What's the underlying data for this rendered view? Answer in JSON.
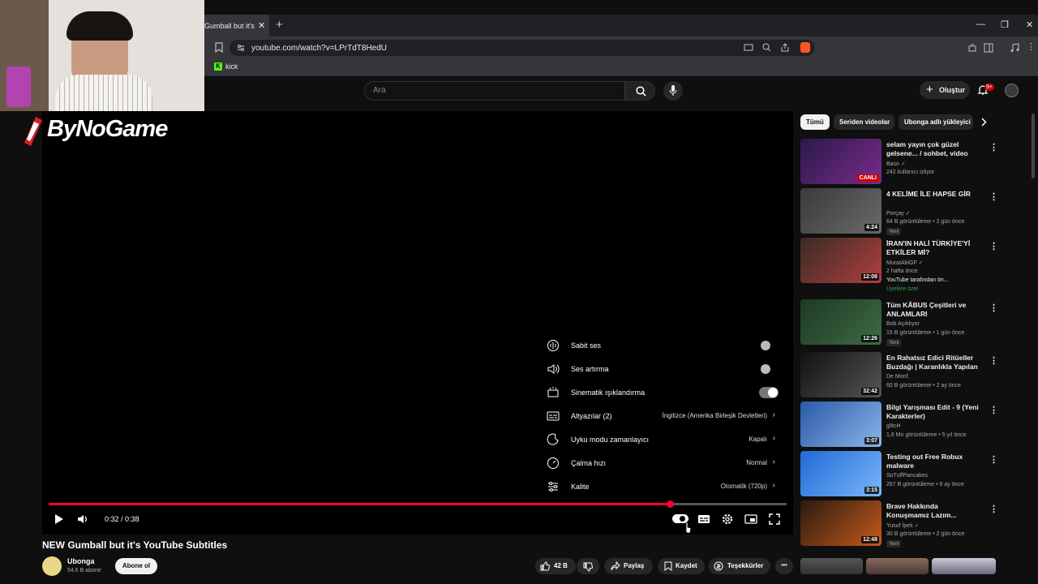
{
  "browser": {
    "tab_title": "Gumball but it's",
    "tab_close": "✕",
    "new_tab": "+",
    "url": "youtube.com/watch?v=LPrTdT8HedU",
    "bookmark_kick": "kick",
    "win_min": "—",
    "win_max": "❐",
    "win_close": "✕"
  },
  "header": {
    "search_placeholder": "Ara",
    "create_label": "Oluştur",
    "notif_count": "9+"
  },
  "overlay": {
    "logo_text": "ByNoGame"
  },
  "settings_menu": {
    "items": [
      {
        "label": "Sabit ses",
        "value": "",
        "icon": "volume-bars-icon",
        "control": "toggle-off"
      },
      {
        "label": "Ses artırma",
        "value": "",
        "icon": "volume-boost-icon",
        "control": "toggle-off"
      },
      {
        "label": "Sinematik ışıklandırma",
        "value": "",
        "icon": "ambient-mode-icon",
        "control": "toggle-on"
      },
      {
        "label": "Altyazılar (2)",
        "value": "İngilizce (Amerika Birleşik Devletleri)",
        "icon": "subtitles-icon",
        "control": "chevron"
      },
      {
        "label": "Uyku modu zamanlayıcı",
        "value": "Kapalı",
        "icon": "sleep-timer-icon",
        "control": "chevron"
      },
      {
        "label": "Çalma hızı",
        "value": "Normal",
        "icon": "playback-speed-icon",
        "control": "chevron"
      },
      {
        "label": "Kalite",
        "value": "Otomatik (720p)",
        "icon": "quality-icon",
        "control": "chevron"
      }
    ],
    "chevron": "›"
  },
  "player": {
    "time": "0:32 / 0:38",
    "progress": 0.842
  },
  "video": {
    "title": "NEW Gumball but it's YouTube Subtitles",
    "channel": "Ubonga",
    "subs": "54.6 B abone",
    "subscribe_label": "Abone ol",
    "likes": "42 B",
    "share_label": "Paylaş",
    "save_label": "Kaydet",
    "thanks_label": "Teşekkürler",
    "more": "•••"
  },
  "sidebar": {
    "chips": [
      "Tümü",
      "Seriden videolar",
      "Ubonga adlı yükleyici"
    ],
    "more": "⋮",
    "recs": [
      {
        "title": "selam yayın çok güzel gelsene... / sohbet, video izleme / zula(?)...",
        "channel": "Baso ✓",
        "meta": "242 kullanıcı izliyor",
        "badge": "",
        "dur": "",
        "live": "CANLI",
        "c1": "#2a1a4a",
        "c2": "#7a2a8a"
      },
      {
        "title": "4 KELİME İLE HAPSE GİR",
        "channel": "Porçay ✓",
        "meta": "64 B görüntüleme • 2 gün önce",
        "badge": "Yeni",
        "dur": "4:24",
        "live": "",
        "c1": "#3a3a3a",
        "c2": "#6a6a6a"
      },
      {
        "title": "İRAN'IN HALİ TÜRKİYE'Yİ ETKİLER Mİ? @YusufKayaalp ...",
        "channel": "MuratAbiGF ✓",
        "meta": "2 hafta önce",
        "badge": "",
        "dur": "12:08",
        "live": "",
        "c1": "#3a2a24",
        "c2": "#b04040"
      },
      {
        "title": "Tüm KÂBUS Çeşitleri ve ANLAMLARI",
        "channel": "Bob Açıklıyor",
        "meta": "15 B görüntüleme • 1 gün önce",
        "badge": "Yeni",
        "dur": "12:26",
        "live": "",
        "c1": "#1e3a24",
        "c2": "#3e6a44"
      },
      {
        "title": "En Rahatsız Edici Ritüeller Buzdağı | Karanlıkla Yapılan ...",
        "channel": "De Monf.",
        "meta": "60 B görüntüleme • 2 ay önce",
        "badge": "",
        "dur": "32:42",
        "live": "",
        "c1": "#111111",
        "c2": "#555555"
      },
      {
        "title": "Bilgi Yarışması Edit - 9 (Yeni Karakterler)",
        "channel": "glitcH",
        "meta": "1,6 Mn görüntüleme • 5 yıl önce",
        "badge": "",
        "dur": "3:07",
        "live": "",
        "c1": "#2a5aa8",
        "c2": "#8ab4e8"
      },
      {
        "title": "Testing out Free Robux malware",
        "channel": "SoTuffPancakes",
        "meta": "267 B görüntüleme • 8 ay önce",
        "badge": "",
        "dur": "3:15",
        "live": "",
        "c1": "#1e6ad8",
        "c2": "#7ab6f8"
      },
      {
        "title": "Brave Hakkında Konuşmamız Lazım...",
        "channel": "Yusuf İpek ✓",
        "meta": "30 B görüntüleme • 2 gün önce",
        "badge": "Yeni",
        "dur": "12:48",
        "live": "",
        "c1": "#2a1a10",
        "c2": "#c45a1a"
      }
    ],
    "extra": {
      "ch_3": "YouTube tarafından ön...",
      "badge_3": "Üyelere özel"
    }
  }
}
